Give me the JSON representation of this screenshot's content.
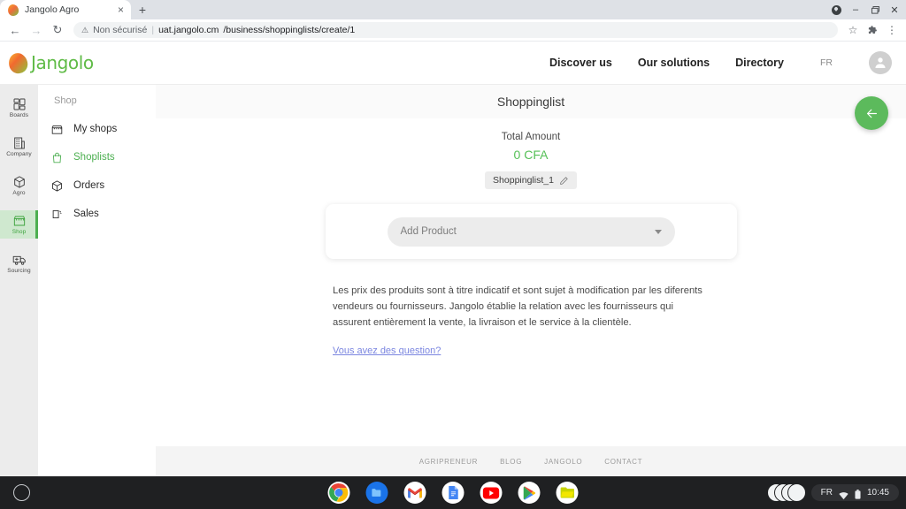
{
  "browser": {
    "tab": {
      "title": "Jangolo Agro",
      "favicon": "jangolo-mango-icon",
      "close": "×"
    },
    "new_tab_label": "+",
    "window_controls": {
      "minimize": "–",
      "maximize": "❐",
      "close": "✕"
    },
    "nav": {
      "back": "←",
      "forward": "→",
      "reload": "↻"
    },
    "omnibox": {
      "warning_icon": "⚠",
      "security_label": "Non sécurisé",
      "separator": "|",
      "url_host": "uat.jangolo.cm",
      "url_path": "/business/shoppinglists/create/1"
    },
    "toolbar_icons": {
      "bookmark": "☆",
      "extensions": "❖",
      "menu": "⋮"
    }
  },
  "header": {
    "logo_text": "Jangolo",
    "nav_links": [
      "Discover us",
      "Our solutions",
      "Directory"
    ],
    "language": "FR",
    "avatar": "account-avatar"
  },
  "icon_rail": [
    {
      "label": "Boards",
      "icon": "boards-icon",
      "active": false
    },
    {
      "label": "Company",
      "icon": "company-icon",
      "active": false
    },
    {
      "label": "Agro",
      "icon": "agro-box-icon",
      "active": false
    },
    {
      "label": "Shop",
      "icon": "shop-icon",
      "active": true
    },
    {
      "label": "Sourcing",
      "icon": "sourcing-truck-icon",
      "active": false
    }
  ],
  "sub_sidebar": {
    "title": "Shop",
    "items": [
      {
        "label": "My shops",
        "icon": "store-icon",
        "active": false
      },
      {
        "label": "Shoplists",
        "icon": "shopping-bag-icon",
        "active": true
      },
      {
        "label": "Orders",
        "icon": "orders-box-icon",
        "active": false
      },
      {
        "label": "Sales",
        "icon": "sales-cards-icon",
        "active": false
      }
    ]
  },
  "main": {
    "page_title": "Shoppinglist",
    "back_fab": "back-arrow-icon",
    "total_amount_label": "Total Amount",
    "total_amount_value": "0 CFA",
    "list_name": "Shoppinglist_1",
    "edit_icon": "pencil-edit-icon",
    "add_product_placeholder": "Add Product",
    "dropdown_caret": "chevron-down-icon",
    "disclaimer": "Les prix des produits sont à titre indicatif et sont sujet à modification par les diferents vendeurs ou fournisseurs. Jangolo établie la relation avec les fournisseurs qui assurent entièrement la vente, la livraison et le service à la clientèle.",
    "question_link": "Vous avez des question?"
  },
  "footer": {
    "links": [
      "AGRIPRENEUR",
      "BLOG",
      "JANGOLO",
      "CONTACT"
    ]
  },
  "shelf": {
    "launcher": "launcher-circle-icon",
    "apps": [
      {
        "name": "chrome-icon",
        "running": true
      },
      {
        "name": "files-icon",
        "running": false
      },
      {
        "name": "gmail-icon",
        "running": true
      },
      {
        "name": "docs-icon",
        "running": false
      },
      {
        "name": "youtube-icon",
        "running": true
      },
      {
        "name": "play-store-icon",
        "running": false
      },
      {
        "name": "green-app-icon",
        "running": false
      }
    ],
    "tray": {
      "language": "FR",
      "wifi": "wifi-icon",
      "battery": "battery-icon",
      "clock": "10:45"
    }
  },
  "colors": {
    "brand_green": "#4caf50",
    "fab_green": "#5cba5c",
    "link_blue": "#7b86e0",
    "rail_bg": "#ececec"
  }
}
